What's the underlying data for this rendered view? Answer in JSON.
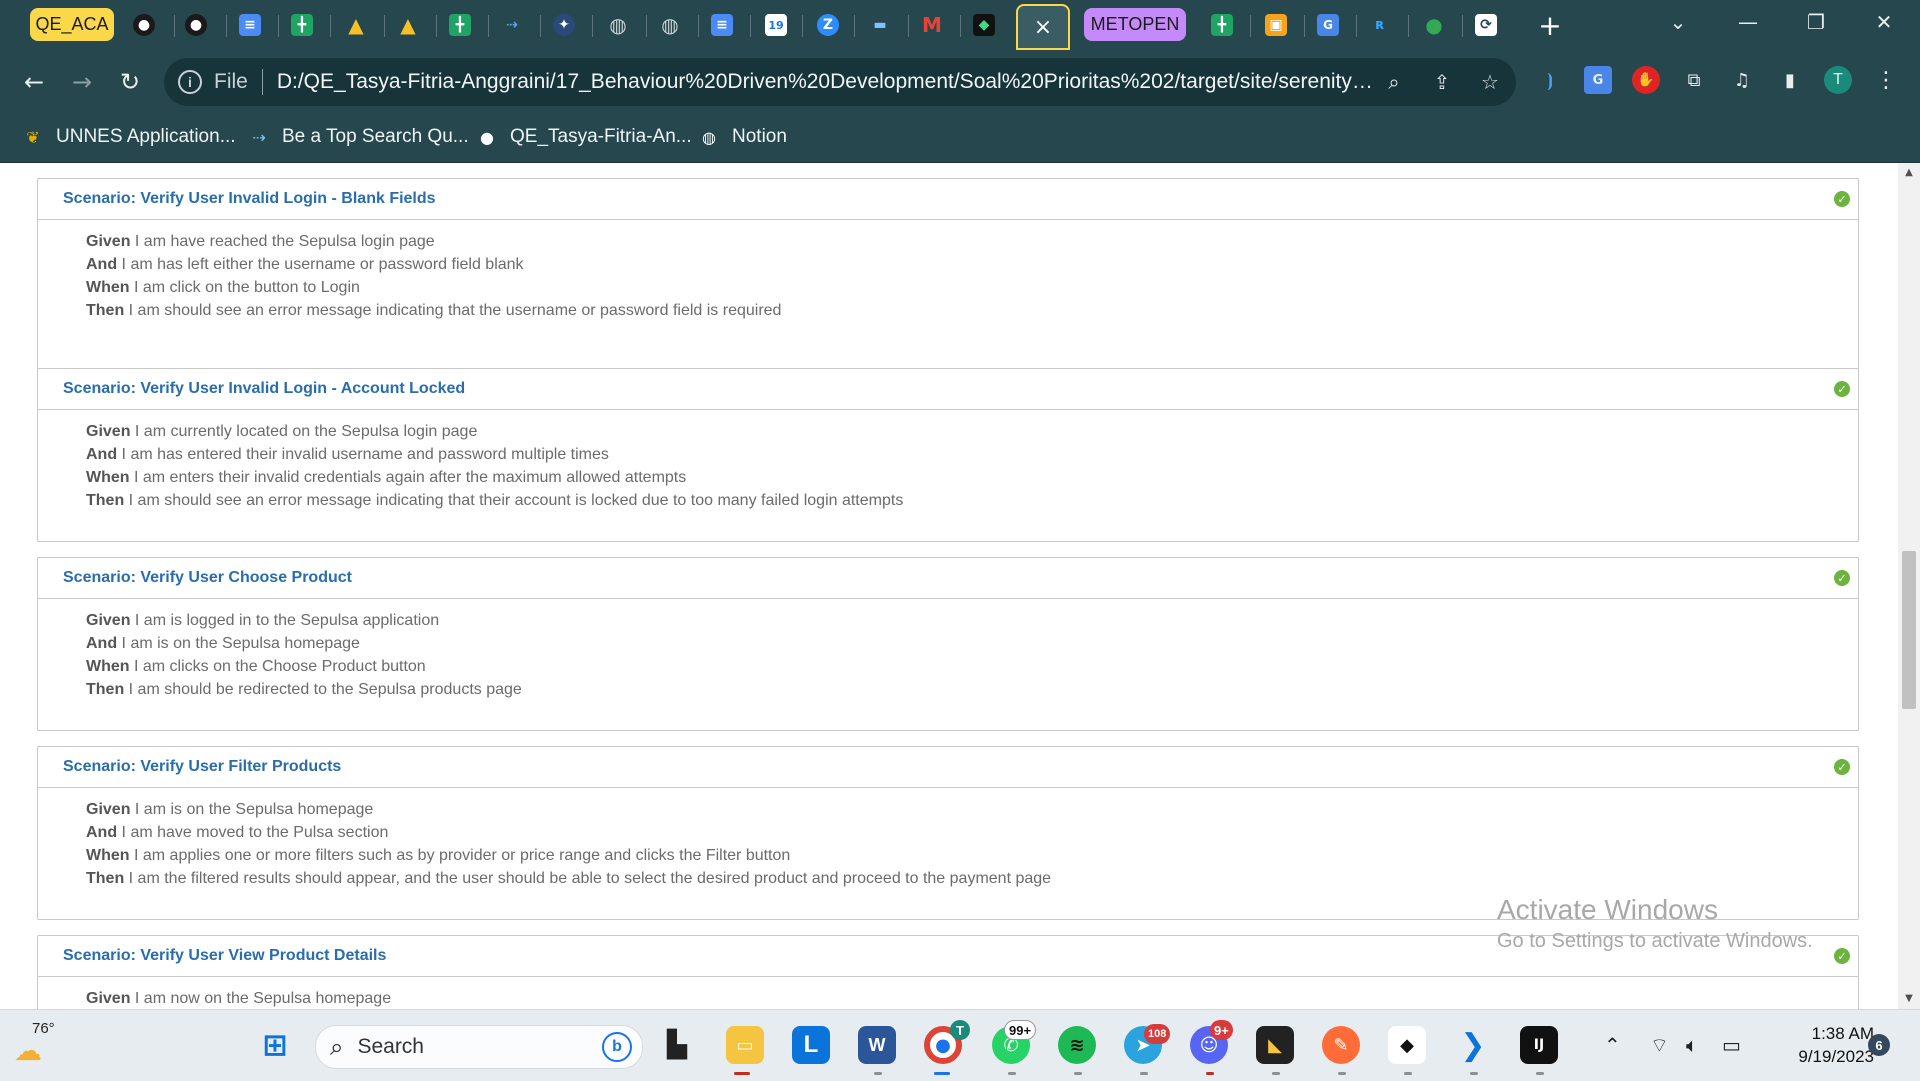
{
  "browser": {
    "tab_groups": [
      {
        "label": "QE_ACA",
        "color": "#fbd84a"
      },
      {
        "label": "METOPEN",
        "color": "#c58af9"
      }
    ],
    "active_tab_close": "×",
    "new_tab": "+",
    "file_scheme": "File",
    "url": "D:/QE_Tasya-Fitria-Anggraini/17_Behaviour%20Driven%20Development/Soal%20Prioritas%202/target/site/serenity/1...",
    "profile_initial": "T",
    "bookmarks": [
      {
        "label": "UNNES Application..."
      },
      {
        "label": "Be a Top Search Qu..."
      },
      {
        "label": "QE_Tasya-Fitria-An..."
      },
      {
        "label": "Notion"
      }
    ]
  },
  "scenarios": [
    {
      "title": "Scenario: Verify User Invalid Login - Blank Fields",
      "steps": [
        {
          "kw": "Given",
          "text": " I am have reached the Sepulsa login page"
        },
        {
          "kw": "And",
          "text": " I am has left either the username or password field blank"
        },
        {
          "kw": "When",
          "text": " I am click on the button to Login"
        },
        {
          "kw": "Then",
          "text": " I am should see an error message indicating that the username or password field is required"
        }
      ]
    },
    {
      "title": "Scenario: Verify User Invalid Login - Account Locked",
      "steps": [
        {
          "kw": "Given",
          "text": " I am currently located on the Sepulsa login page"
        },
        {
          "kw": "And",
          "text": " I am has entered their invalid username and password multiple times"
        },
        {
          "kw": "When",
          "text": " I am enters their invalid credentials again after the maximum allowed attempts"
        },
        {
          "kw": "Then",
          "text": " I am should see an error message indicating that their account is locked due to too many failed login attempts"
        }
      ]
    },
    {
      "title": "Scenario: Verify User Choose Product",
      "steps": [
        {
          "kw": "Given",
          "text": " I am is logged in to the Sepulsa application"
        },
        {
          "kw": "And",
          "text": " I am is on the Sepulsa homepage"
        },
        {
          "kw": "When",
          "text": " I am clicks on the Choose Product button"
        },
        {
          "kw": "Then",
          "text": " I am should be redirected to the Sepulsa products page"
        }
      ]
    },
    {
      "title": "Scenario: Verify User Filter Products",
      "steps": [
        {
          "kw": "Given",
          "text": " I am is on the Sepulsa homepage"
        },
        {
          "kw": "And",
          "text": " I am have moved to the Pulsa section"
        },
        {
          "kw": "When",
          "text": " I am applies one or more filters such as by provider or price range and clicks the Filter button"
        },
        {
          "kw": "Then",
          "text": " I am the filtered results should appear, and the user should be able to select the desired product and proceed to the payment page"
        }
      ]
    },
    {
      "title": "Scenario: Verify User View Product Details",
      "steps": [
        {
          "kw": "Given",
          "text": " I am now on the Sepulsa homepage"
        }
      ]
    }
  ],
  "watermark": {
    "line1": "Activate Windows",
    "line2": "Go to Settings to activate Windows."
  },
  "taskbar": {
    "weather_temp": "76°",
    "search_placeholder": "Search",
    "whatsapp_badge": "99+",
    "telegram_badge": "108",
    "discord_badge": "9+",
    "chrome_badge": "T",
    "time": "1:38 AM",
    "date": "9/19/2023",
    "notification_count": "6"
  }
}
